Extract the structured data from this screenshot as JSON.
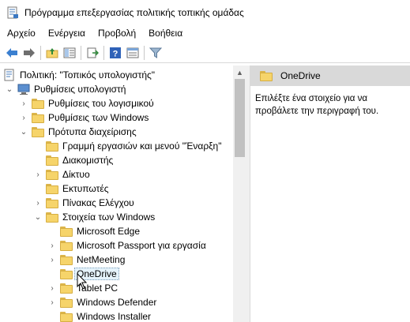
{
  "window": {
    "title": "Πρόγραμμα επεξεργασίας πολιτικής τοπικής ομάδας"
  },
  "menubar": {
    "items": [
      "Αρχείο",
      "Ενέργεια",
      "Προβολή",
      "Βοήθεια"
    ]
  },
  "toolbar": {
    "buttons": [
      "back-icon",
      "forward-icon",
      "up-folder-icon",
      "show-hide-tree-icon",
      "export-list-icon",
      "help-icon",
      "properties-view-icon",
      "filter-icon"
    ]
  },
  "tree": {
    "items": [
      {
        "label": "Πολιτική: \"Τοπικός υπολογιστής\"",
        "icon": "computer-policy-icon"
      },
      {
        "label": "Ρυθμίσεις υπολογιστή",
        "icon": "computer-icon"
      },
      {
        "label": "Ρυθμίσεις του λογισμικού",
        "icon": "folder-icon"
      },
      {
        "label": "Ρυθμίσεις των Windows",
        "icon": "folder-icon"
      },
      {
        "label": "Πρότυπα διαχείρισης",
        "icon": "folder-icon"
      },
      {
        "label": "Γραμμή εργασιών και μενού \"Έναρξη\"",
        "icon": "folder-icon"
      },
      {
        "label": "Διακομιστής",
        "icon": "folder-icon"
      },
      {
        "label": "Δίκτυο",
        "icon": "folder-icon"
      },
      {
        "label": "Εκτυπωτές",
        "icon": "folder-icon"
      },
      {
        "label": "Πίνακας Ελέγχου",
        "icon": "folder-icon"
      },
      {
        "label": "Στοιχεία των Windows",
        "icon": "folder-icon"
      },
      {
        "label": "Microsoft Edge",
        "icon": "folder-icon"
      },
      {
        "label": "Microsoft Passport για εργασία",
        "icon": "folder-icon"
      },
      {
        "label": "NetMeeting",
        "icon": "folder-icon"
      },
      {
        "label": "OneDrive",
        "icon": "folder-icon"
      },
      {
        "label": "Tablet PC",
        "icon": "folder-icon"
      },
      {
        "label": "Windows Defender",
        "icon": "folder-icon"
      },
      {
        "label": "Windows Installer",
        "icon": "folder-icon"
      }
    ]
  },
  "details": {
    "header": "OneDrive",
    "description": "Επιλέξτε ένα στοιχείο για να προβάλετε την περιγραφή του."
  },
  "colors": {
    "folder_fill": "#f6d46a",
    "selection": "#e5f3fb",
    "header_bg": "#d9d9d9"
  }
}
